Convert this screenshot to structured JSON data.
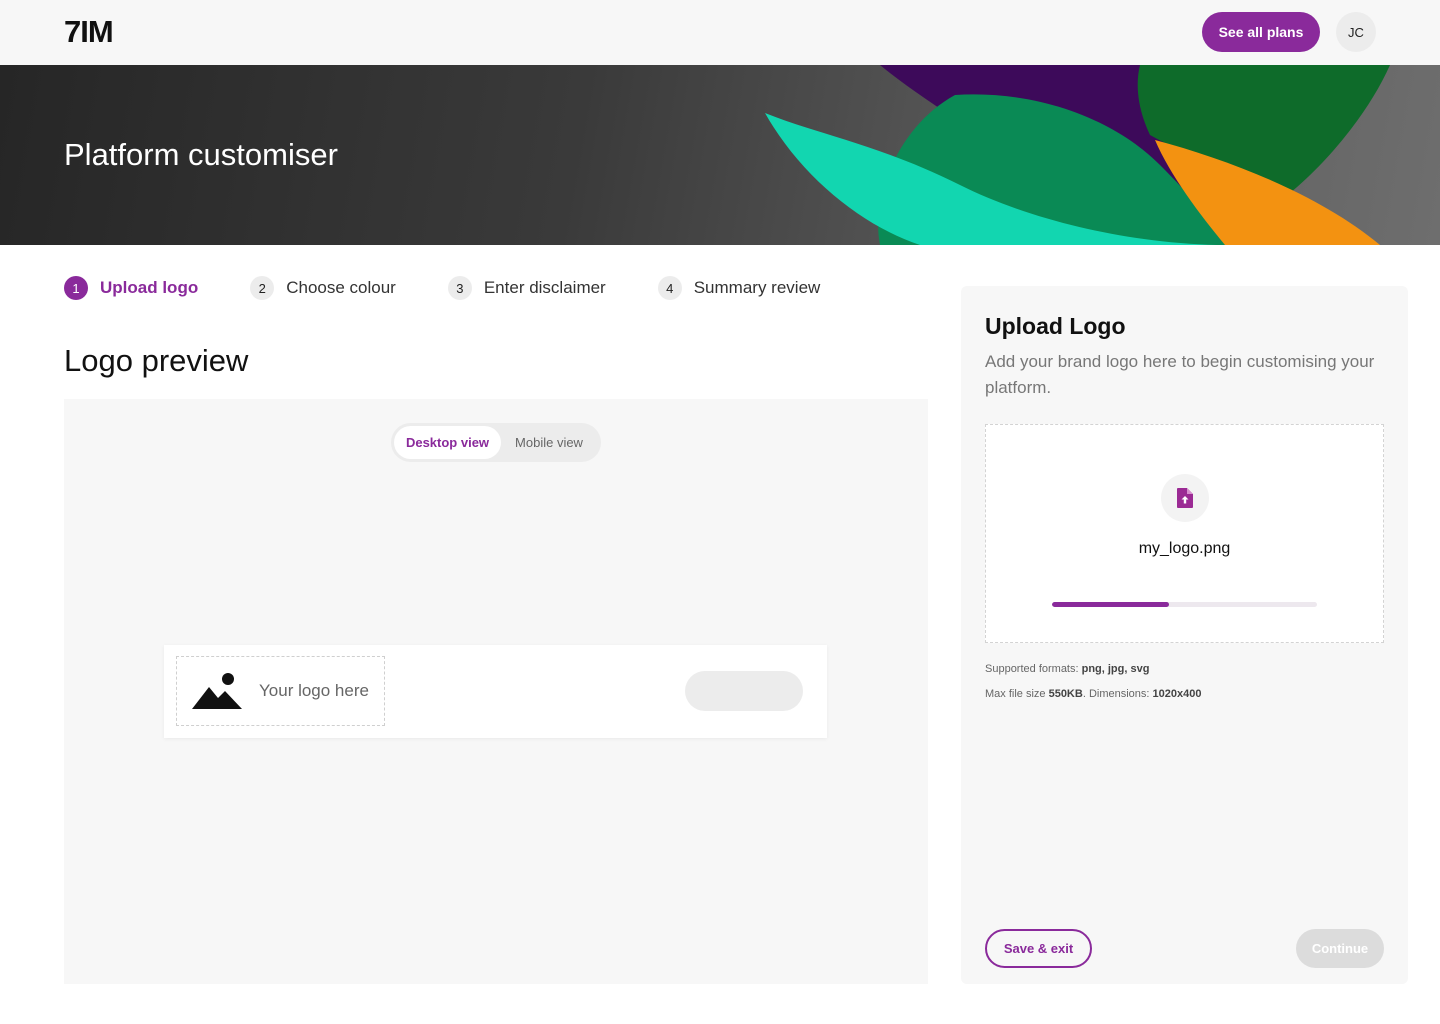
{
  "header": {
    "brand": "7IM",
    "plans_label": "See all plans",
    "avatar_initials": "JC"
  },
  "hero": {
    "title": "Platform customiser",
    "colors": {
      "purple": "#3d0a5a",
      "green": "#0a8a55",
      "teal": "#12d6b0",
      "orange": "#f39211",
      "dark_green": "#0e6b2a"
    }
  },
  "stepper": {
    "steps": [
      {
        "num": "1",
        "label": "Upload logo",
        "active": true
      },
      {
        "num": "2",
        "label": "Choose colour",
        "active": false
      },
      {
        "num": "3",
        "label": "Enter disclaimer",
        "active": false
      },
      {
        "num": "4",
        "label": "Summary review",
        "active": false
      }
    ]
  },
  "preview": {
    "title": "Logo preview",
    "views": [
      "Desktop view",
      "Mobile view"
    ],
    "selected_view": "Desktop view",
    "logo_placeholder": "Your logo here",
    "placeholder_icon": "landscape-image-icon"
  },
  "upload": {
    "title": "Upload Logo",
    "description": "Add your brand logo here to begin customising your platform.",
    "file_icon": "file-upload-icon",
    "file_name": "my_logo.png",
    "progress_percent": 44,
    "formats_label": "Supported formats: ",
    "formats_value": "png, jpg, svg",
    "size_label": "Max file size ",
    "size_value": "550KB",
    "dimensions_label": ". Dimensions: ",
    "dimensions_value": "1020x400",
    "save_label": "Save & exit",
    "continue_label": "Continue"
  },
  "theme": {
    "accent": "#8a2a9b",
    "panel_bg": "#f7f7f7",
    "disabled": "#dcdcdc"
  }
}
